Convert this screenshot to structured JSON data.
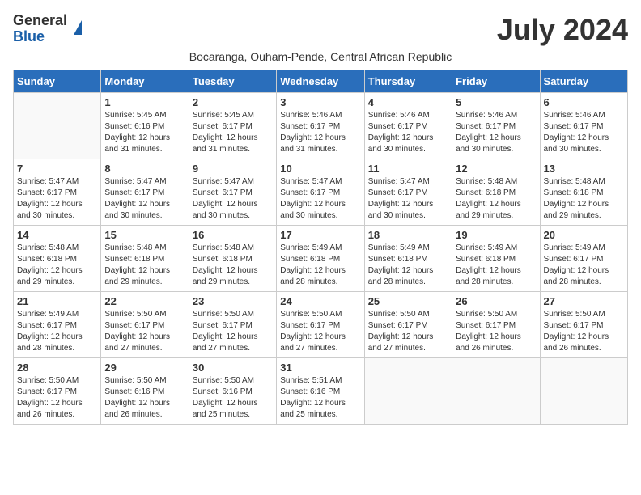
{
  "logo": {
    "general": "General",
    "blue": "Blue"
  },
  "title": "July 2024",
  "subtitle": "Bocaranga, Ouham-Pende, Central African Republic",
  "days_of_week": [
    "Sunday",
    "Monday",
    "Tuesday",
    "Wednesday",
    "Thursday",
    "Friday",
    "Saturday"
  ],
  "weeks": [
    [
      {
        "day": "",
        "info": ""
      },
      {
        "day": "1",
        "info": "Sunrise: 5:45 AM\nSunset: 6:16 PM\nDaylight: 12 hours\nand 31 minutes."
      },
      {
        "day": "2",
        "info": "Sunrise: 5:45 AM\nSunset: 6:17 PM\nDaylight: 12 hours\nand 31 minutes."
      },
      {
        "day": "3",
        "info": "Sunrise: 5:46 AM\nSunset: 6:17 PM\nDaylight: 12 hours\nand 31 minutes."
      },
      {
        "day": "4",
        "info": "Sunrise: 5:46 AM\nSunset: 6:17 PM\nDaylight: 12 hours\nand 30 minutes."
      },
      {
        "day": "5",
        "info": "Sunrise: 5:46 AM\nSunset: 6:17 PM\nDaylight: 12 hours\nand 30 minutes."
      },
      {
        "day": "6",
        "info": "Sunrise: 5:46 AM\nSunset: 6:17 PM\nDaylight: 12 hours\nand 30 minutes."
      }
    ],
    [
      {
        "day": "7",
        "info": "Sunrise: 5:47 AM\nSunset: 6:17 PM\nDaylight: 12 hours\nand 30 minutes."
      },
      {
        "day": "8",
        "info": "Sunrise: 5:47 AM\nSunset: 6:17 PM\nDaylight: 12 hours\nand 30 minutes."
      },
      {
        "day": "9",
        "info": "Sunrise: 5:47 AM\nSunset: 6:17 PM\nDaylight: 12 hours\nand 30 minutes."
      },
      {
        "day": "10",
        "info": "Sunrise: 5:47 AM\nSunset: 6:17 PM\nDaylight: 12 hours\nand 30 minutes."
      },
      {
        "day": "11",
        "info": "Sunrise: 5:47 AM\nSunset: 6:17 PM\nDaylight: 12 hours\nand 30 minutes."
      },
      {
        "day": "12",
        "info": "Sunrise: 5:48 AM\nSunset: 6:18 PM\nDaylight: 12 hours\nand 29 minutes."
      },
      {
        "day": "13",
        "info": "Sunrise: 5:48 AM\nSunset: 6:18 PM\nDaylight: 12 hours\nand 29 minutes."
      }
    ],
    [
      {
        "day": "14",
        "info": "Sunrise: 5:48 AM\nSunset: 6:18 PM\nDaylight: 12 hours\nand 29 minutes."
      },
      {
        "day": "15",
        "info": "Sunrise: 5:48 AM\nSunset: 6:18 PM\nDaylight: 12 hours\nand 29 minutes."
      },
      {
        "day": "16",
        "info": "Sunrise: 5:48 AM\nSunset: 6:18 PM\nDaylight: 12 hours\nand 29 minutes."
      },
      {
        "day": "17",
        "info": "Sunrise: 5:49 AM\nSunset: 6:18 PM\nDaylight: 12 hours\nand 28 minutes."
      },
      {
        "day": "18",
        "info": "Sunrise: 5:49 AM\nSunset: 6:18 PM\nDaylight: 12 hours\nand 28 minutes."
      },
      {
        "day": "19",
        "info": "Sunrise: 5:49 AM\nSunset: 6:18 PM\nDaylight: 12 hours\nand 28 minutes."
      },
      {
        "day": "20",
        "info": "Sunrise: 5:49 AM\nSunset: 6:17 PM\nDaylight: 12 hours\nand 28 minutes."
      }
    ],
    [
      {
        "day": "21",
        "info": "Sunrise: 5:49 AM\nSunset: 6:17 PM\nDaylight: 12 hours\nand 28 minutes."
      },
      {
        "day": "22",
        "info": "Sunrise: 5:50 AM\nSunset: 6:17 PM\nDaylight: 12 hours\nand 27 minutes."
      },
      {
        "day": "23",
        "info": "Sunrise: 5:50 AM\nSunset: 6:17 PM\nDaylight: 12 hours\nand 27 minutes."
      },
      {
        "day": "24",
        "info": "Sunrise: 5:50 AM\nSunset: 6:17 PM\nDaylight: 12 hours\nand 27 minutes."
      },
      {
        "day": "25",
        "info": "Sunrise: 5:50 AM\nSunset: 6:17 PM\nDaylight: 12 hours\nand 27 minutes."
      },
      {
        "day": "26",
        "info": "Sunrise: 5:50 AM\nSunset: 6:17 PM\nDaylight: 12 hours\nand 26 minutes."
      },
      {
        "day": "27",
        "info": "Sunrise: 5:50 AM\nSunset: 6:17 PM\nDaylight: 12 hours\nand 26 minutes."
      }
    ],
    [
      {
        "day": "28",
        "info": "Sunrise: 5:50 AM\nSunset: 6:17 PM\nDaylight: 12 hours\nand 26 minutes."
      },
      {
        "day": "29",
        "info": "Sunrise: 5:50 AM\nSunset: 6:16 PM\nDaylight: 12 hours\nand 26 minutes."
      },
      {
        "day": "30",
        "info": "Sunrise: 5:50 AM\nSunset: 6:16 PM\nDaylight: 12 hours\nand 25 minutes."
      },
      {
        "day": "31",
        "info": "Sunrise: 5:51 AM\nSunset: 6:16 PM\nDaylight: 12 hours\nand 25 minutes."
      },
      {
        "day": "",
        "info": ""
      },
      {
        "day": "",
        "info": ""
      },
      {
        "day": "",
        "info": ""
      }
    ]
  ]
}
